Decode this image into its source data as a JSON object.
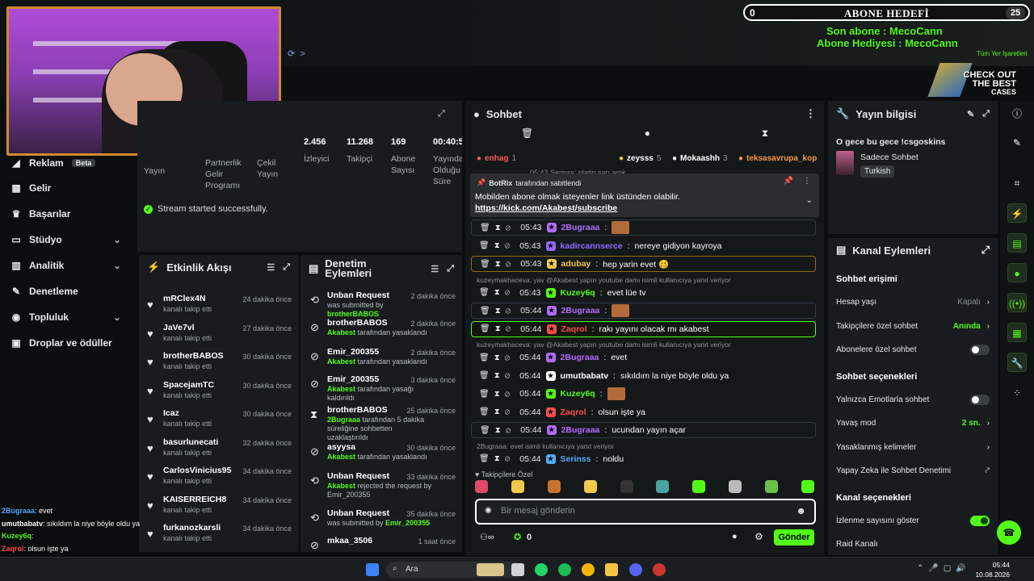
{
  "goal": {
    "label": "ABONE HEDEFİ",
    "current": "0",
    "target": "25",
    "last_sub": "Son abone : MecoCann",
    "last_gift": "Abone Hediyesi : MecoCann"
  },
  "top_right": {
    "bookmarks": "Tüm Yer İşaretleri"
  },
  "ad": {
    "line1": "CHECK OUT",
    "line2": "THE BEST",
    "line3": "CASES"
  },
  "nav": {
    "items": [
      {
        "label": "Reklam",
        "badge": "Beta"
      },
      {
        "label": "Gelir"
      },
      {
        "label": "Başarılar"
      },
      {
        "label": "Stüdyo"
      },
      {
        "label": "Analitik"
      },
      {
        "label": "Denetleme"
      },
      {
        "label": "Topluluk"
      },
      {
        "label": "Droplar ve ödüller"
      }
    ]
  },
  "stats": {
    "partial_a": "Yayın",
    "partial_b": "Partnerlik Gelir Programı",
    "partial_c": "Çekil Yayın",
    "items": [
      {
        "value": "2.456",
        "label": "İzleyici"
      },
      {
        "value": "11.268",
        "label": "Takipçi"
      },
      {
        "value": "169",
        "label": "Abone Sayısı"
      },
      {
        "value": "00:40:5",
        "label": "Yayında Olduğu Süre"
      }
    ],
    "success": "Stream started successfully."
  },
  "feed": {
    "title": "Etkinlik Akışı",
    "rows": [
      {
        "name": "mRClex4N",
        "sub": "kanalı takip etti",
        "time": "24 dakika önce"
      },
      {
        "name": "JaVe7vl",
        "sub": "kanalı takip etti",
        "time": "27 dakika önce"
      },
      {
        "name": "brotherBABOS",
        "sub": "kanalı takip etti",
        "time": "30 dakika önce"
      },
      {
        "name": "SpacejamTC",
        "sub": "kanalı takip etti",
        "time": "30 dakika önce"
      },
      {
        "name": "Icaz",
        "sub": "kanalı takip etti",
        "time": "30 dakika önce"
      },
      {
        "name": "basurlunecati",
        "sub": "kanalı takip etti",
        "time": "32 dakika önce"
      },
      {
        "name": "CarlosVinicius95",
        "sub": "kanalı takip etti",
        "time": "34 dakika önce"
      },
      {
        "name": "KAISERREICH8",
        "sub": "kanalı takip etti",
        "time": "34 dakika önce"
      },
      {
        "name": "furkanozkarsli",
        "sub": "kanalı takip etti",
        "time": "34 dakika önce"
      }
    ]
  },
  "moderation": {
    "title": "Denetim Eylemleri",
    "rows": [
      {
        "name": "Unban Request",
        "pre": "was submitted by ",
        "hl": "brotherBABOS",
        "post": "",
        "time": "2 dakika önce"
      },
      {
        "name": "brotherBABOS",
        "pre": "",
        "hl": "Akabest",
        "post": " tarafından yasaklandı",
        "time": "2 dakika önce"
      },
      {
        "name": "Emir_200355",
        "pre": "",
        "hl": "Akabest",
        "post": " tarafından yasaklandı",
        "time": "2 dakika önce"
      },
      {
        "name": "Emir_200355",
        "pre": "",
        "hl": "Akabest",
        "post": " tarafından yasağı kaldırıldı",
        "time": "3 dakika önce"
      },
      {
        "name": "brotherBABOS",
        "pre": "",
        "hl": "2Bugraaa",
        "post": " tarafından 5 dakika süreliğine sohbetten uzaklaştırıldı",
        "time": "25 dakika önce"
      },
      {
        "name": "asyysa",
        "pre": "",
        "hl": "Akabest",
        "post": " tarafından yasaklandı",
        "time": "30 dakika önce"
      },
      {
        "name": "Unban Request",
        "pre": "",
        "hl": "Akabest",
        "post": " rejected the request by Emir_200355",
        "time": "33 dakika önce"
      },
      {
        "name": "Unban Request",
        "pre": "was submitted by ",
        "hl": "Emir_200355",
        "post": "",
        "time": "35 dakika önce"
      },
      {
        "name": "mkaa_3506",
        "pre": "",
        "hl": "",
        "post": "",
        "time": "1 saat önce"
      }
    ]
  },
  "overlay_chat": [
    {
      "user": "2Bugraaa",
      "text": ": evet",
      "color": "#57a9ff"
    },
    {
      "user": "umutbabatv",
      "text": ": sıkıldım la niye böyle oldu ya",
      "color": "#ffffff"
    },
    {
      "user": "Kuzey6q",
      "text": ":",
      "color": "#53fc18"
    },
    {
      "user": "Zaqrol",
      "text": ": olsun işte ya",
      "color": "#ff4d4d"
    },
    {
      "user": "2Bugraaa",
      "text": ": ucundan yayın açar",
      "color": "#57a9ff"
    },
    {
      "user": "Serinss",
      "text": ": noldu",
      "color": "#57a9ff"
    }
  ],
  "chat": {
    "title": "Sohbet",
    "leaderboard": [
      {
        "name": "enhag",
        "count": "1",
        "color": "#f25a5a"
      },
      {
        "name": "zeysss",
        "count": "5",
        "color": "#f2c94c"
      },
      {
        "name": "Mokaashh",
        "count": "3",
        "color": "#ffffff"
      },
      {
        "name": "teksasavrupa_kop",
        "count": "",
        "color": "#f2994a"
      }
    ],
    "pinned": {
      "by": "BotRix",
      "by_suffix": "tarafından sabitlendi",
      "text": "Mobilden abone olmak isteyenler link üstünden olabilir.",
      "link": "https://kick.com/Akabest/subscribe"
    },
    "partial_top": "05:43  Serinss: platin sarı amk",
    "messages": [
      {
        "time": "05:43",
        "user": "2Bugraaa",
        "color": "#b36bff",
        "text": "",
        "emote": true,
        "hl": "box"
      },
      {
        "time": "05:43",
        "user": "kadircannserce",
        "color": "#8f6bff",
        "text": "nereye gidiyon kayroya",
        "emote": false,
        "hl": ""
      },
      {
        "time": "05:43",
        "user": "adubay",
        "color": "#f2c94c",
        "text": "hep yarin evet 🥴",
        "emote": false,
        "hl": "gold"
      },
      {
        "time": "05:43",
        "user": "Kuzey6q",
        "color": "#53fc18",
        "text": "evet lüe tv",
        "emote": false,
        "hl": "",
        "reply": "kuzeymakhaceva: yav @Akabest yapın youtube damı isimli kullanıcıya yanıt veriyor"
      },
      {
        "time": "05:44",
        "user": "2Bugraaa",
        "color": "#b36bff",
        "text": "",
        "emote": true,
        "hl": "box"
      },
      {
        "time": "05:44",
        "user": "Zaqrol",
        "color": "#ff4d4d",
        "text": "rakı yayını olacak mı akabest",
        "emote": false,
        "hl": "green"
      },
      {
        "time": "05:44",
        "user": "2Bugraaa",
        "color": "#b36bff",
        "text": "evet",
        "emote": false,
        "hl": "",
        "reply": "kuzeymakhaceva: yav @Akabest yapın youtube damı isimli kullanıcıya yanıt veriyor"
      },
      {
        "time": "05:44",
        "user": "umutbabatv",
        "color": "#ffffff",
        "text": "sıkıldım la niye böyle oldu ya",
        "emote": false,
        "hl": ""
      },
      {
        "time": "05:44",
        "user": "Kuzey6q",
        "color": "#53fc18",
        "text": "",
        "emote": true,
        "hl": ""
      },
      {
        "time": "05:44",
        "user": "Zaqrol",
        "color": "#ff4d4d",
        "text": "olsun işte ya",
        "emote": false,
        "hl": ""
      },
      {
        "time": "05:44",
        "user": "2Bugraaa",
        "color": "#b36bff",
        "text": "ucundan yayın açar",
        "emote": false,
        "hl": "box"
      },
      {
        "time": "05:44",
        "user": "Serinss",
        "color": "#57a9ff",
        "text": "noldu",
        "emote": false,
        "hl": "",
        "reply": "2Bugraaa: evet isimli kullanıcıya yanıt veriyor"
      }
    ],
    "followers_only": "Takipçilere Özel",
    "input_placeholder": "Bir mesaj gönderin",
    "coins": "0",
    "send": "Gönder"
  },
  "stream_info": {
    "title": "Yayın bilgisi",
    "stream_title": "O gece bu gece !csgoskins",
    "category": "Sadece Sohbet",
    "tag": "Turkish"
  },
  "channel_actions": {
    "title": "Kanal Eylemleri",
    "section1": "Sohbet erişimi",
    "row1": {
      "label": "Hesap yaşı",
      "value": "Kapalı"
    },
    "row2": {
      "label": "Takipçilere özel sohbet",
      "value": "Anında"
    },
    "row3": {
      "label": "Abonelere özel sohbet"
    },
    "section2": "Sohbet seçenekleri",
    "row4": {
      "label": "Yalnızca Emotlarla sohbet"
    },
    "row5": {
      "label": "Yavaş mod",
      "value": "2 sn."
    },
    "row6": {
      "label": "Yasaklanmış kelimeler"
    },
    "row7": {
      "label": "Yapay Zeka ile Sohbet Denetimi"
    },
    "section3": "Kanal seçenekleri",
    "row8": {
      "label": "İzlenme sayısını göster"
    },
    "row9": {
      "label": "Raid Kanalı"
    }
  },
  "taskbar": {
    "search": "Ara",
    "time": "05:44",
    "date": "10.08.2026"
  }
}
